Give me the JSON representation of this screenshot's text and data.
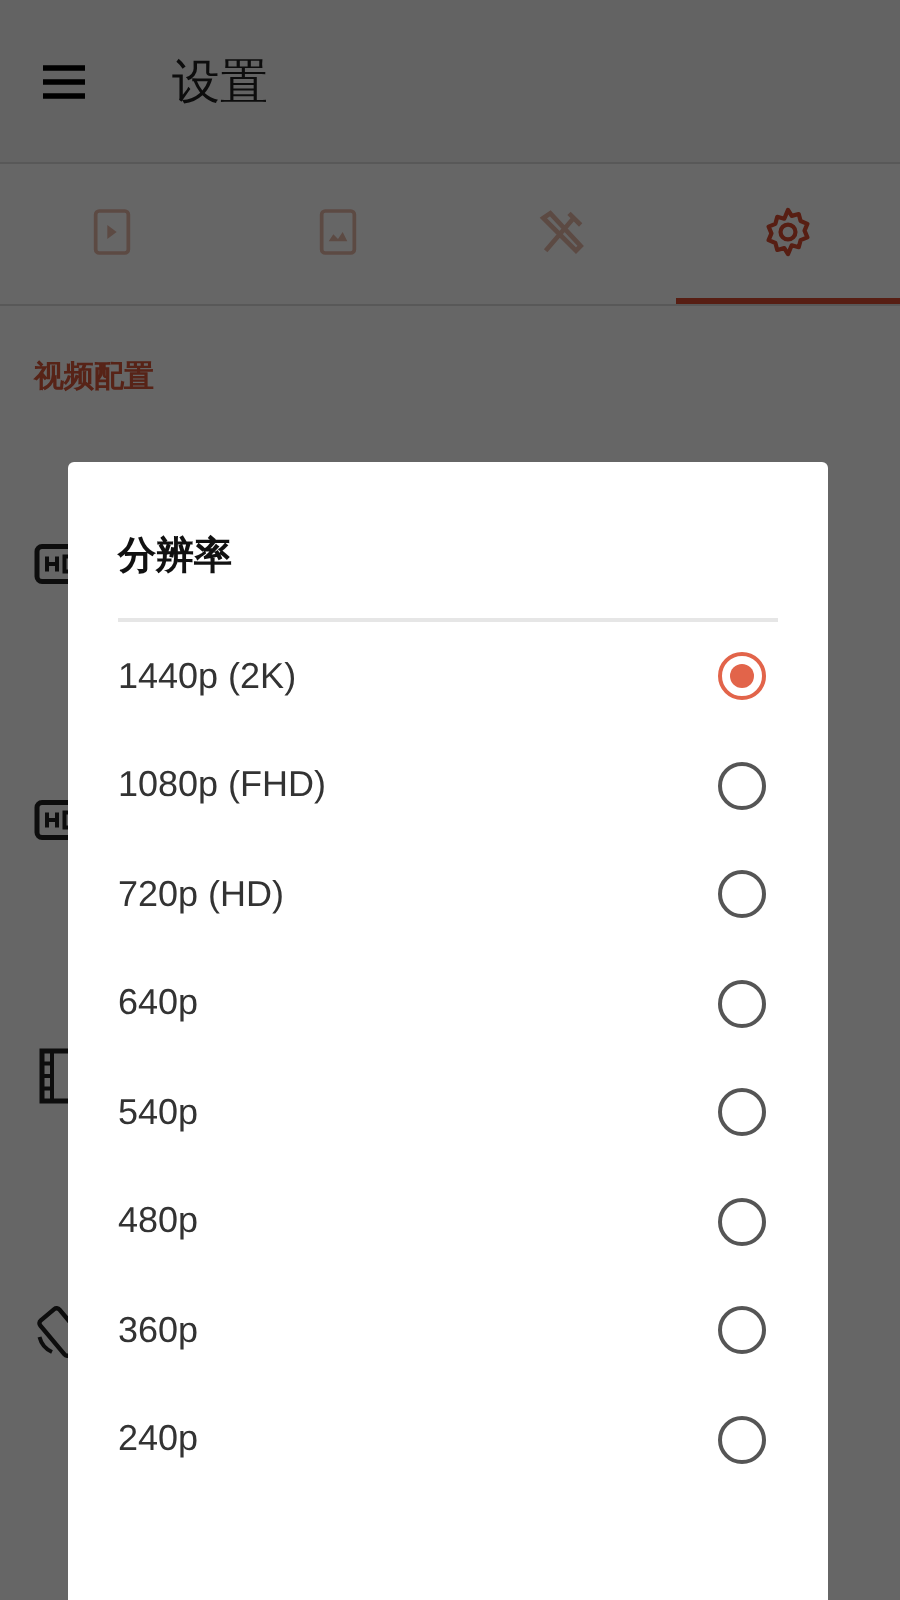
{
  "app_bar": {
    "title": "设置"
  },
  "tabs": [
    {
      "selected": false
    },
    {
      "selected": false
    },
    {
      "selected": false
    },
    {
      "selected": true
    }
  ],
  "section_title": "视频配置",
  "dialog": {
    "title": "分辨率",
    "options": [
      {
        "label": "1440p (2K)",
        "selected": true
      },
      {
        "label": "1080p (FHD)",
        "selected": false
      },
      {
        "label": "720p (HD)",
        "selected": false
      },
      {
        "label": "640p",
        "selected": false
      },
      {
        "label": "540p",
        "selected": false
      },
      {
        "label": "480p",
        "selected": false
      },
      {
        "label": "360p",
        "selected": false
      },
      {
        "label": "240p",
        "selected": false
      }
    ]
  }
}
